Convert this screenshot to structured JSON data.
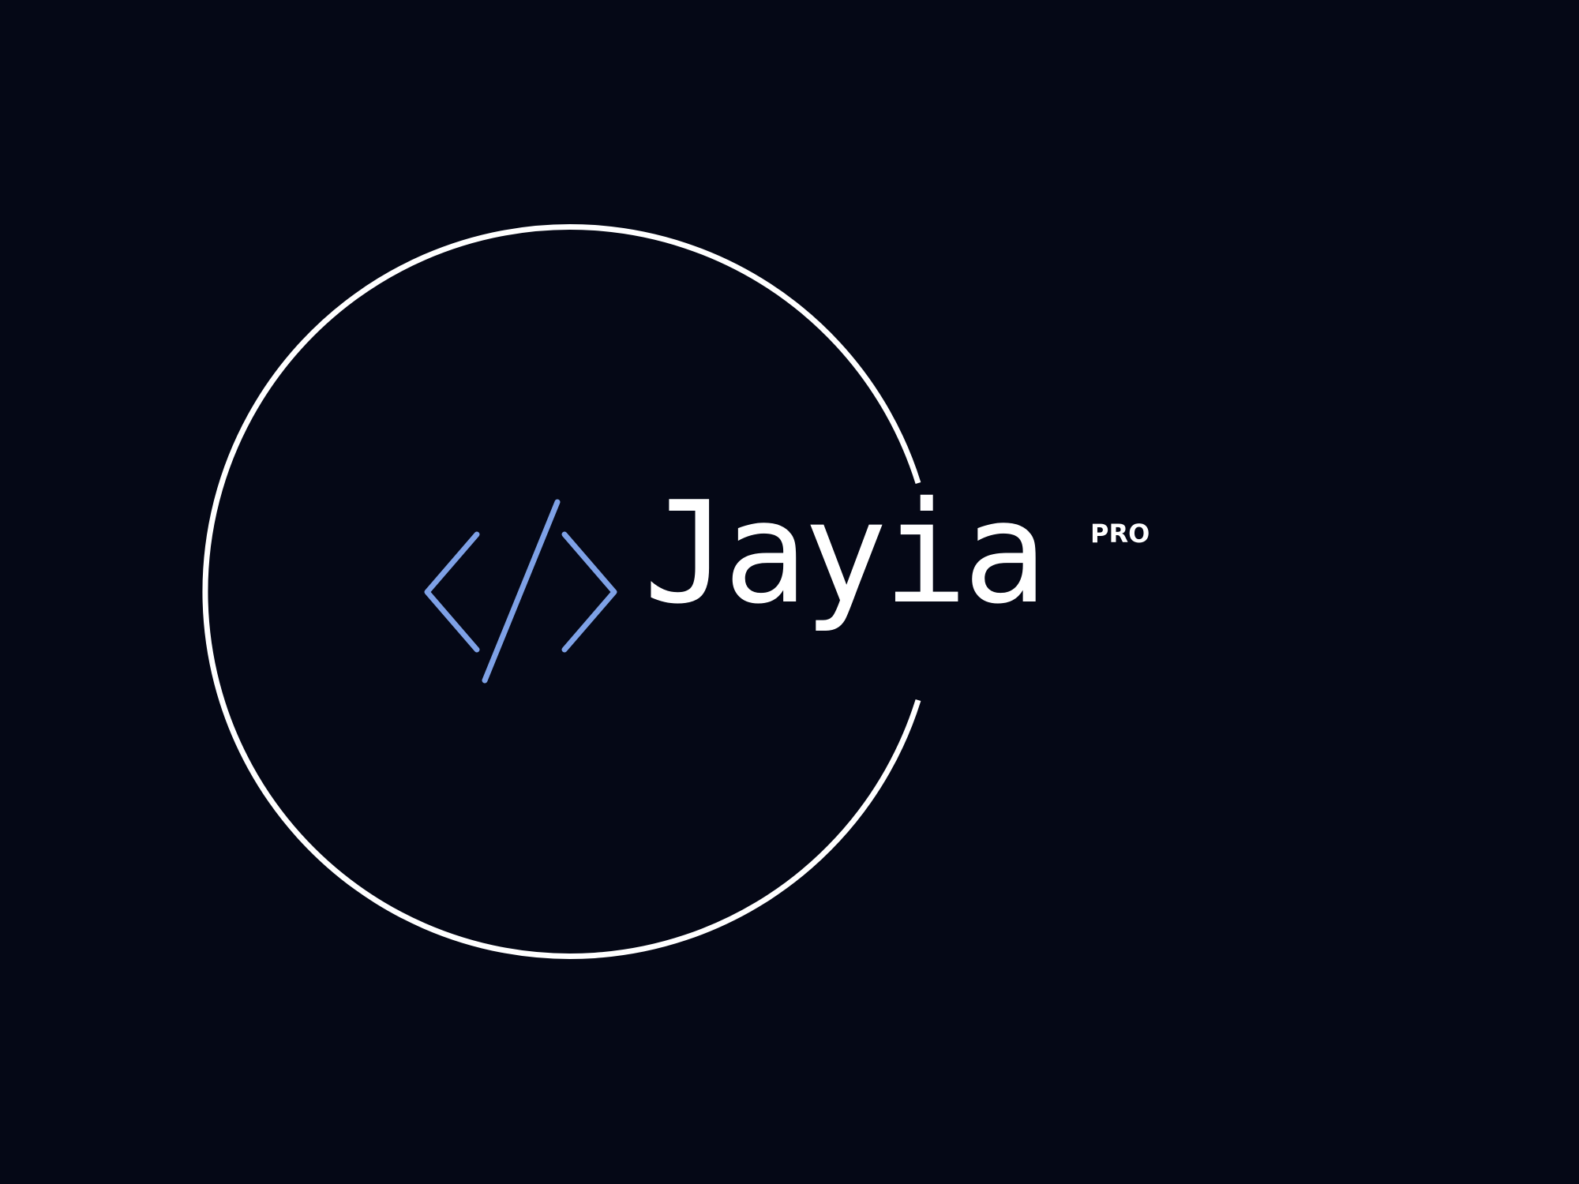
{
  "brand": {
    "name": "Jayia",
    "badge": "PRO",
    "icon": "code-brackets-icon"
  },
  "colors": {
    "background": "#050816",
    "ring": "#ffffff",
    "icon": "#7ea1e6",
    "text": "#ffffff"
  }
}
